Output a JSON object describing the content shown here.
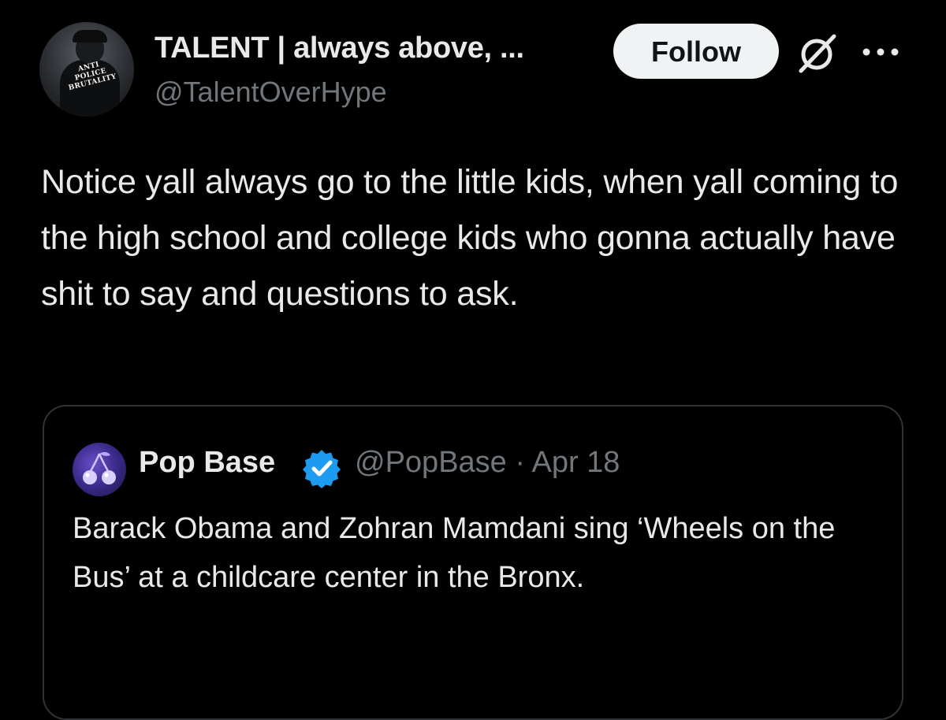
{
  "tweet": {
    "author": {
      "display_name": "TALENT | always above, ...",
      "handle": "@TalentOverHype",
      "avatar_shirt_text": [
        "ANTI",
        "POLICE",
        "BRUTALITY"
      ]
    },
    "follow_label": "Follow",
    "icons": {
      "grok": "grok-icon",
      "more": "more-icon"
    },
    "text": "Notice yall always go to the little kids, when yall coming to the high school and college kids who gonna actually have shit to say and questions to ask."
  },
  "quote": {
    "author_name": "Pop Base",
    "verified": true,
    "handle": "@PopBase",
    "separator": "·",
    "date": "Apr 18",
    "meta": "@PopBase · Apr 18",
    "text": "Barack Obama and Zohran Mamdani sing ‘Wheels on the Bus’ at a childcare center in the Bronx."
  },
  "colors": {
    "background": "#000000",
    "primary_text": "#e7e9ea",
    "secondary_text": "#71767b",
    "border": "#2f3336",
    "verified_blue": "#1d9bf0",
    "follow_bg": "#eff3f4"
  }
}
